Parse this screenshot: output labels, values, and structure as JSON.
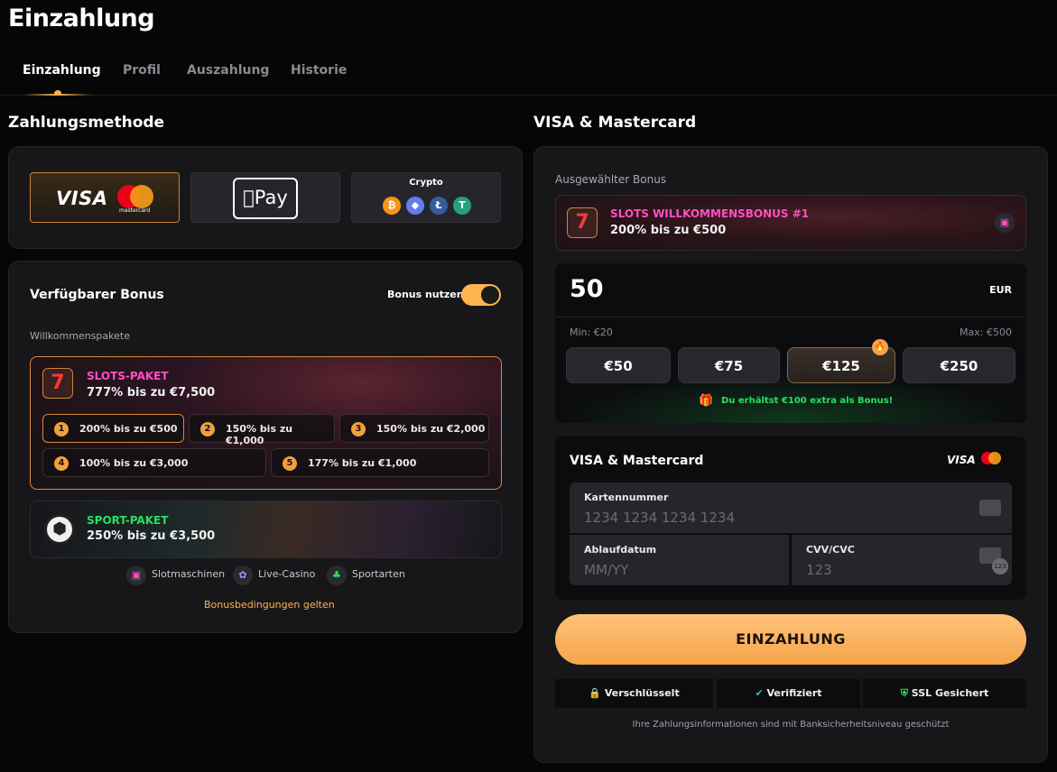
{
  "page": {
    "title": "Einzahlung"
  },
  "tabs": [
    {
      "label": "Einzahlung",
      "active": true
    },
    {
      "label": "Profil"
    },
    {
      "label": "Auszahlung"
    },
    {
      "label": "Historie"
    }
  ],
  "left": {
    "section_title": "Zahlungsmethode",
    "methods": {
      "visa": "VISA",
      "mastercard_caption": "mastercard",
      "applepay": "Pay",
      "crypto_label": "Crypto",
      "coins": [
        "bitcoin-icon",
        "ethereum-icon",
        "litecoin-icon",
        "tether-icon"
      ]
    },
    "bonus_panel": {
      "title": "Verfügbarer Bonus",
      "toggle_label": "Bonus nutzen",
      "toggle_on": true,
      "group_label": "Willkommenspakete",
      "slots_pack": {
        "name": "SLOTS-PAKET",
        "subtitle": "777% bis zu €7,500",
        "offers": [
          {
            "num": "1",
            "text": "200% bis zu €500"
          },
          {
            "num": "2",
            "text": "150% bis zu €1,000"
          },
          {
            "num": "3",
            "text": "150% bis zu €2,000"
          },
          {
            "num": "4",
            "text": "100% bis zu €3,000"
          },
          {
            "num": "5",
            "text": "177% bis zu €1,000"
          }
        ]
      },
      "sport_pack": {
        "name": "SPORT-PAKET",
        "subtitle": "250% bis zu €3,500"
      },
      "categories": [
        "Slotmaschinen",
        "Live-Casino",
        "Sportarten"
      ],
      "terms_link": "Bonusbedingungen gelten"
    }
  },
  "right": {
    "section_title": "VISA & Mastercard",
    "selected_bonus_label": "Ausgewählter Bonus",
    "selected_bonus": {
      "name": "SLOTS WILLKOMMENSBONUS #1",
      "subtitle": "200% bis zu €500"
    },
    "amount": {
      "value": "50",
      "currency": "EUR",
      "min": "Min: €20",
      "max": "Max: €500"
    },
    "chips": [
      "€50",
      "€75",
      "€125",
      "€250"
    ],
    "extra_bonus": "Du erhältst €100 extra als Bonus!",
    "card": {
      "title": "VISA & Mastercard",
      "visa": "VISA",
      "number_label": "Kartennummer",
      "number_placeholder": "1234 1234 1234 1234",
      "expiry_label": "Ablaufdatum",
      "expiry_placeholder": "MM/YY",
      "cvv_label": "CVV/CVC",
      "cvv_placeholder": "123",
      "cvv_badge": "123"
    },
    "submit": "EINZAHLUNG",
    "trust": [
      "Verschlüsselt",
      "Verifiziert",
      "SSL Gesichert"
    ],
    "security_note": "Ihre Zahlungsinformationen sind mit Banksicherheitsniveau geschützt"
  },
  "colors": {
    "accent": "#ffb450",
    "pink": "#ff4fc3",
    "green": "#27e060",
    "panel": "#17171a"
  }
}
